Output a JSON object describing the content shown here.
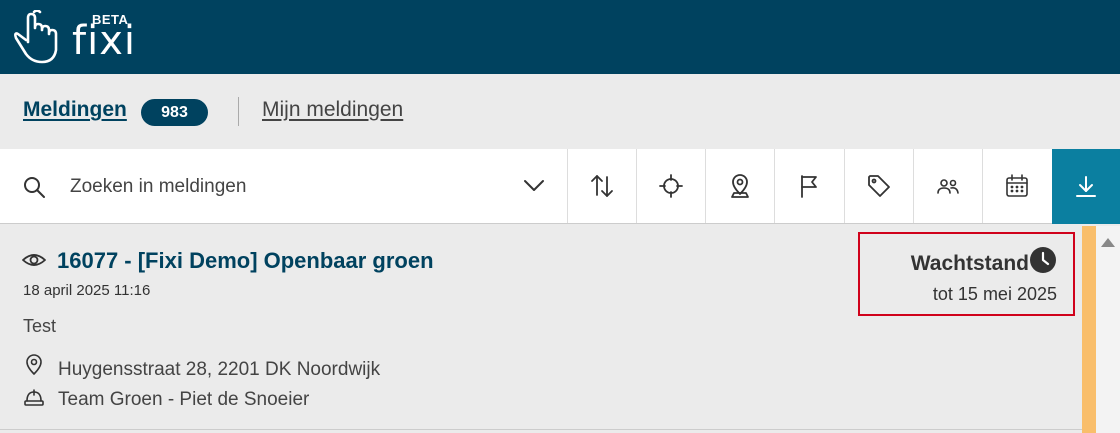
{
  "app": {
    "logo_text": "fixi",
    "logo_badge": "BETA"
  },
  "tabs": {
    "active_label": "Meldingen",
    "active_count": "983",
    "other_label": "Mijn meldingen"
  },
  "toolbar": {
    "search_placeholder": "Zoeken in meldingen",
    "icons": [
      "sort-icon",
      "crosshair-icon",
      "location-user-icon",
      "flag-icon",
      "tag-icon",
      "users-icon",
      "calendar-icon",
      "download-icon"
    ]
  },
  "report": {
    "title": "16077 - [Fixi Demo] Openbaar groen",
    "date": "18 april 2025 11:16",
    "description": "Test",
    "address": "Huygensstraat 28, 2201 DK Noordwijk",
    "team": "Team Groen - Piet de Snoeier",
    "status": "Wachtstand",
    "status_until": "tot 15 mei 2025",
    "status_color": "#f9be6b"
  },
  "colors": {
    "brand": "#00425f",
    "accent": "#0b7fa0",
    "highlight": "#d0021b"
  }
}
